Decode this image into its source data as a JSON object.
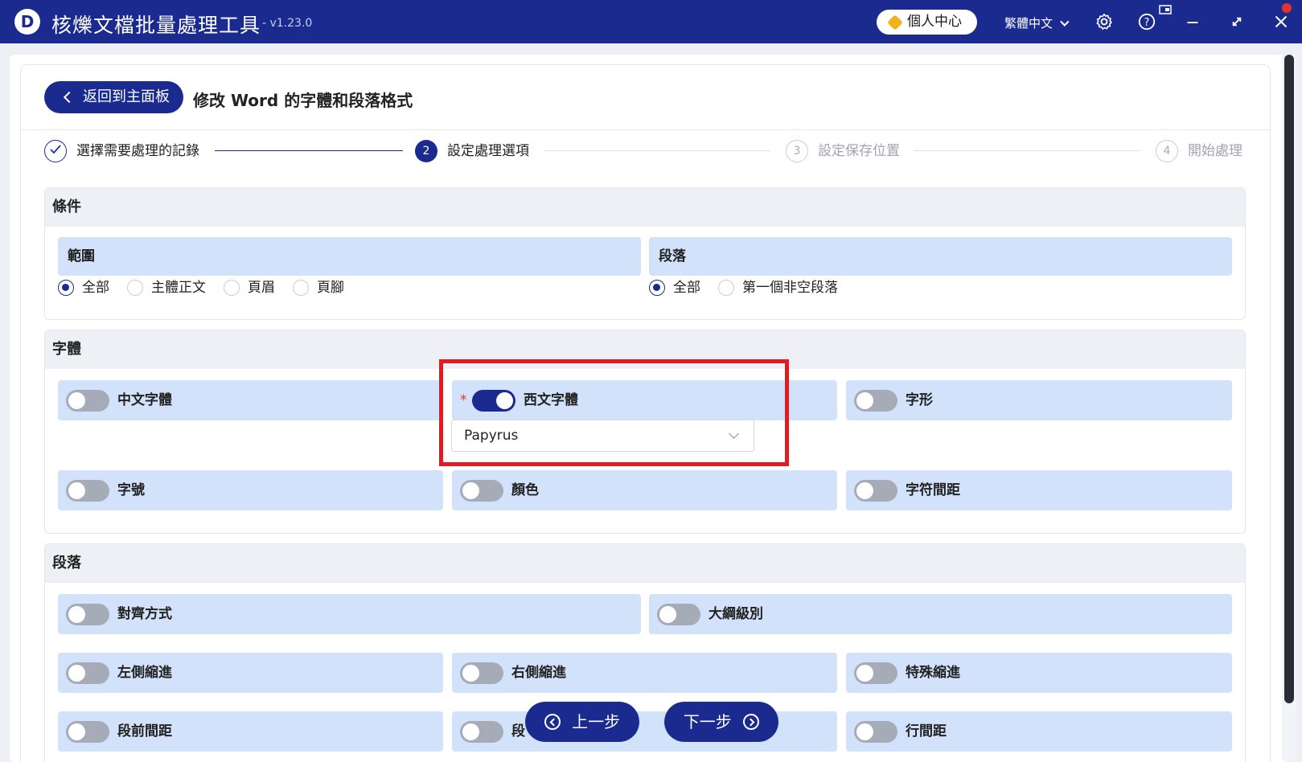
{
  "titlebar": {
    "logo_letter": "D",
    "app_name": "核爍文檔批量處理工具",
    "version": "- v1.23.0",
    "user_center": "個人中心",
    "language": "繁體中文"
  },
  "header": {
    "back_label": "返回到主面板",
    "page_title": "修改 Word 的字體和段落格式"
  },
  "steps": [
    {
      "number": "",
      "label": "選擇需要處理的記錄",
      "state": "done"
    },
    {
      "number": "2",
      "label": "設定處理選項",
      "state": "active"
    },
    {
      "number": "3",
      "label": "設定保存位置",
      "state": "pending"
    },
    {
      "number": "4",
      "label": "開始處理",
      "state": "pending"
    }
  ],
  "conditions": {
    "title": "條件",
    "range": {
      "title": "範圍",
      "options": [
        "全部",
        "主體正文",
        "頁眉",
        "頁腳"
      ],
      "selected": "全部"
    },
    "paragraph": {
      "title": "段落",
      "options": [
        "全部",
        "第一個非空段落"
      ],
      "selected": "全部"
    }
  },
  "font": {
    "title": "字體",
    "options": [
      {
        "label": "中文字體",
        "enabled": false
      },
      {
        "label": "西文字體",
        "enabled": true,
        "required_mark": "*",
        "value": "Papyrus"
      },
      {
        "label": "字形",
        "enabled": false
      },
      {
        "label": "字號",
        "enabled": false
      },
      {
        "label": "顏色",
        "enabled": false
      },
      {
        "label": "字符間距",
        "enabled": false
      }
    ]
  },
  "paragraph_section": {
    "title": "段落",
    "options": [
      {
        "label": "對齊方式",
        "enabled": false
      },
      {
        "label": "大綱級別",
        "enabled": false
      },
      {
        "label": "左側縮進",
        "enabled": false
      },
      {
        "label": "右側縮進",
        "enabled": false
      },
      {
        "label": "特殊縮進",
        "enabled": false
      },
      {
        "label": "段前間距",
        "enabled": false
      },
      {
        "label": "段",
        "enabled": false
      },
      {
        "label": "行間距",
        "enabled": false
      }
    ]
  },
  "footer": {
    "prev_label": "上一步",
    "next_label": "下一步"
  },
  "colors": {
    "brand": "#1a2a8f",
    "option_bg": "#d3e2fb",
    "highlight": "#e11b22"
  }
}
